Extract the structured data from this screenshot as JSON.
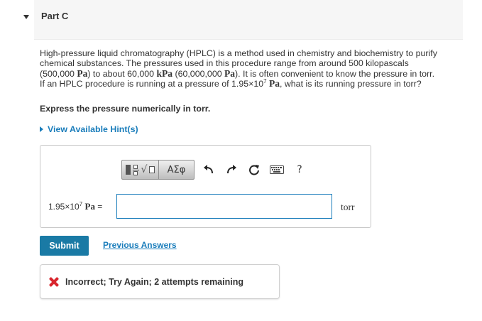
{
  "part": {
    "title": "Part C"
  },
  "question": {
    "line1": "High-pressure liquid chromatography (HPLC) is a method used in chemistry and biochemistry to purify",
    "line2": "chemical substances. The pressures used in this procedure range from around 500 kilopascals",
    "line3_a": "(500,000 ",
    "line3_unit1": "Pa",
    "line3_b": ") to about 60,000 ",
    "line3_unit2": "kPa",
    "line3_c": " (60,000,000 ",
    "line3_unit3": "Pa",
    "line3_d": "). It is often convenient to know the pressure in torr.",
    "line4_a": "If an HPLC procedure is running at a pressure of 1.95×10",
    "line4_exp": "7",
    "line4_unit": " Pa",
    "line4_b": ", what is its running pressure in torr?"
  },
  "instruction": "Express the pressure numerically in torr.",
  "hints": {
    "label": "View Available Hint(s)"
  },
  "toolbar": {
    "greek_label": "ΑΣφ",
    "help_label": "?",
    "icons": [
      "template-icon",
      "undo-icon",
      "redo-icon",
      "reset-icon",
      "keyboard-icon",
      "help-icon"
    ]
  },
  "answer": {
    "label_mantissa": "1.95×10",
    "label_exp": "7",
    "label_unit": "Pa",
    "label_eq": " =",
    "value": "",
    "unit": "torr"
  },
  "actions": {
    "submit_label": "Submit",
    "previous_answers_label": "Previous Answers"
  },
  "feedback": {
    "text": "Incorrect; Try Again; 2 attempts remaining",
    "color": "#d9262e"
  },
  "colors": {
    "accent": "#1a7dbb",
    "submit": "#1a7aa5",
    "header_bg": "#f6f6f6"
  }
}
